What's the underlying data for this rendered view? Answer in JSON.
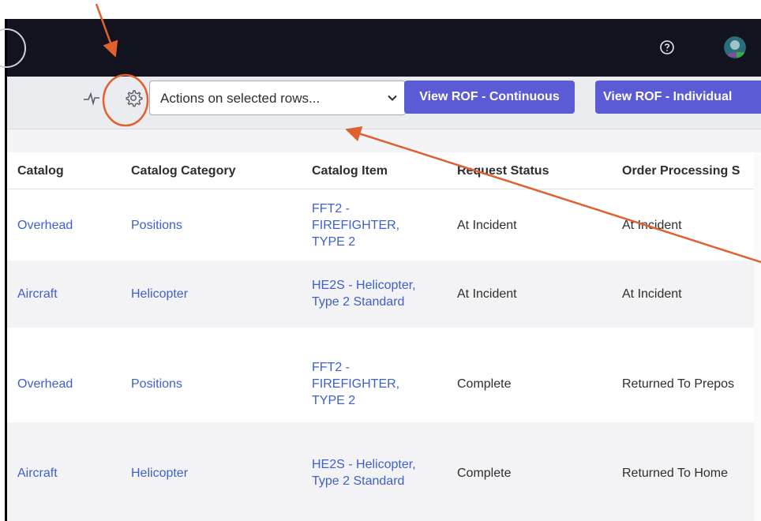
{
  "colors": {
    "navbar": "#13131f",
    "toolbar": "#ebecf0",
    "primary_button": "#5b5bd6",
    "link": "#3d61c9",
    "annotation": "#e0602e",
    "alt_row": "#f3f3f6"
  },
  "navbar": {
    "help_icon": "question-circle-icon",
    "avatar_icon": "user-avatar-icon"
  },
  "toolbar": {
    "activity_icon": "activity-pulse-icon",
    "settings_icon": "gear-icon",
    "actions_placeholder": "Actions on selected rows...",
    "btn_continuous": "View ROF - Continuous",
    "btn_individual": "View ROF - Individual"
  },
  "table": {
    "headers": [
      "Catalog",
      "Catalog Category",
      "Catalog Item",
      "Request Status",
      "Order Processing S"
    ],
    "rows": [
      {
        "catalog": "Overhead",
        "category": "Positions",
        "item_lines": [
          "FFT2 -",
          "FIREFIGHTER,",
          "TYPE 2"
        ],
        "request_status": "At Incident",
        "order_processing": "At Incident"
      },
      {
        "catalog": "Aircraft",
        "category": "Helicopter",
        "item_lines": [
          "HE2S - Helicopter,",
          "Type 2 Standard"
        ],
        "request_status": "At Incident",
        "order_processing": "At Incident"
      },
      {
        "catalog": "Overhead",
        "category": "Positions",
        "item_lines": [
          "FFT2 -",
          "FIREFIGHTER,",
          "TYPE 2"
        ],
        "request_status": "Complete",
        "order_processing": "Returned To Prepos"
      },
      {
        "catalog": "Aircraft",
        "category": "Helicopter",
        "item_lines": [
          "HE2S - Helicopter,",
          "Type 2 Standard"
        ],
        "request_status": "Complete",
        "order_processing": "Returned To Home"
      }
    ]
  }
}
